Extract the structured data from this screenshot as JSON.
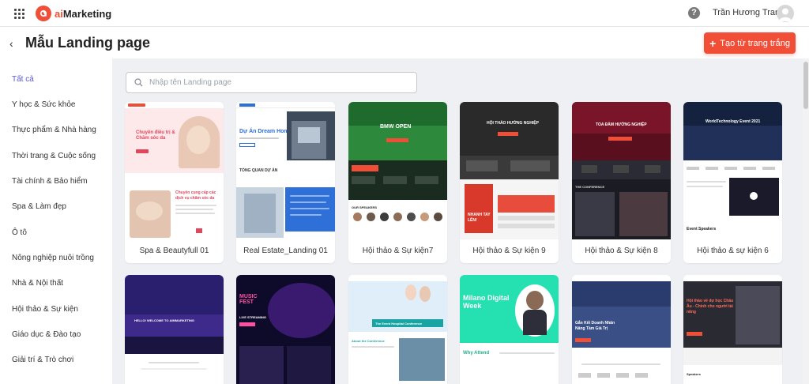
{
  "app": {
    "logo_ai": "ai",
    "logo_rest": "Marketing",
    "user_name": "Trần Hương Trang",
    "accent": "#f04e37",
    "active_color": "#5b57d9"
  },
  "header": {
    "back_icon": "chevron-left-icon",
    "title": "Mẫu Landing page",
    "create_label": "Tạo từ trang trắng"
  },
  "search": {
    "placeholder": "Nhập tên Landing page"
  },
  "sidebar": {
    "items": [
      {
        "label": "Tất cả",
        "active": true
      },
      {
        "label": "Y học & Sức khỏe"
      },
      {
        "label": "Thực phẩm & Nhà hàng"
      },
      {
        "label": "Thời trang & Cuộc sống"
      },
      {
        "label": "Tài chính & Bảo hiểm"
      },
      {
        "label": "Spa & Làm đẹp"
      },
      {
        "label": "Ô tô"
      },
      {
        "label": "Nông nghiệp nuôi trồng"
      },
      {
        "label": "Nhà & Nội thất"
      },
      {
        "label": "Hội thảo & Sự kiện"
      },
      {
        "label": "Giáo dục & Đào tạo"
      },
      {
        "label": "Giải trí & Trò chơi"
      }
    ]
  },
  "templates_row1": [
    {
      "label": "Spa & Beautyfull 01",
      "thumb_title": "Chuyên điều trị & Chăm sóc da",
      "thumb_sub": "Chuyên cung cấp các dịch vụ chăm sóc da"
    },
    {
      "label": "Real Estate_Landing 01",
      "thumb_title": "Dự Án Dream Home",
      "thumb_sub": "TỔNG QUAN DỰ ÁN"
    },
    {
      "label": "Hội thảo & Sự kiện7",
      "thumb_title": "BMW OPEN",
      "thumb_sub": "OUR SPEAKERS"
    },
    {
      "label": "Hội thảo & Sự kiện 9",
      "thumb_title": "HỘI THẢO HƯỚNG NGHIỆP",
      "thumb_sub": "NHANH TAY LÊN!"
    },
    {
      "label": "Hội thảo & Sự kiện 8",
      "thumb_title": "TOA ĐÀM HƯỚNG NGHIỆP",
      "thumb_sub": "THE CONFERENCE"
    },
    {
      "label": "Hội thảo & sự kiện 6",
      "thumb_title": "WorldTechnology Event 2021",
      "thumb_sub": "Event Speakers"
    }
  ],
  "templates_row2": [
    {
      "thumb_title": "HELLO! WELCOME TO AIMMARKETING"
    },
    {
      "thumb_title": "MUSIC FEST",
      "thumb_sub": "LIVE STREAMING"
    },
    {
      "thumb_title": "The Event Hospital Conference",
      "thumb_sub": "About the Conference"
    },
    {
      "thumb_title": "Milano Digital Week",
      "thumb_sub": "Why Attend"
    },
    {
      "thumb_title": "Gắn Kết Doanh Nhân Nâng Tầm Giá Trị"
    },
    {
      "thumb_title": "Hội thảo về dự học Châu Âu - Chính cho người tài năng",
      "thumb_sub": "Speakers"
    }
  ]
}
